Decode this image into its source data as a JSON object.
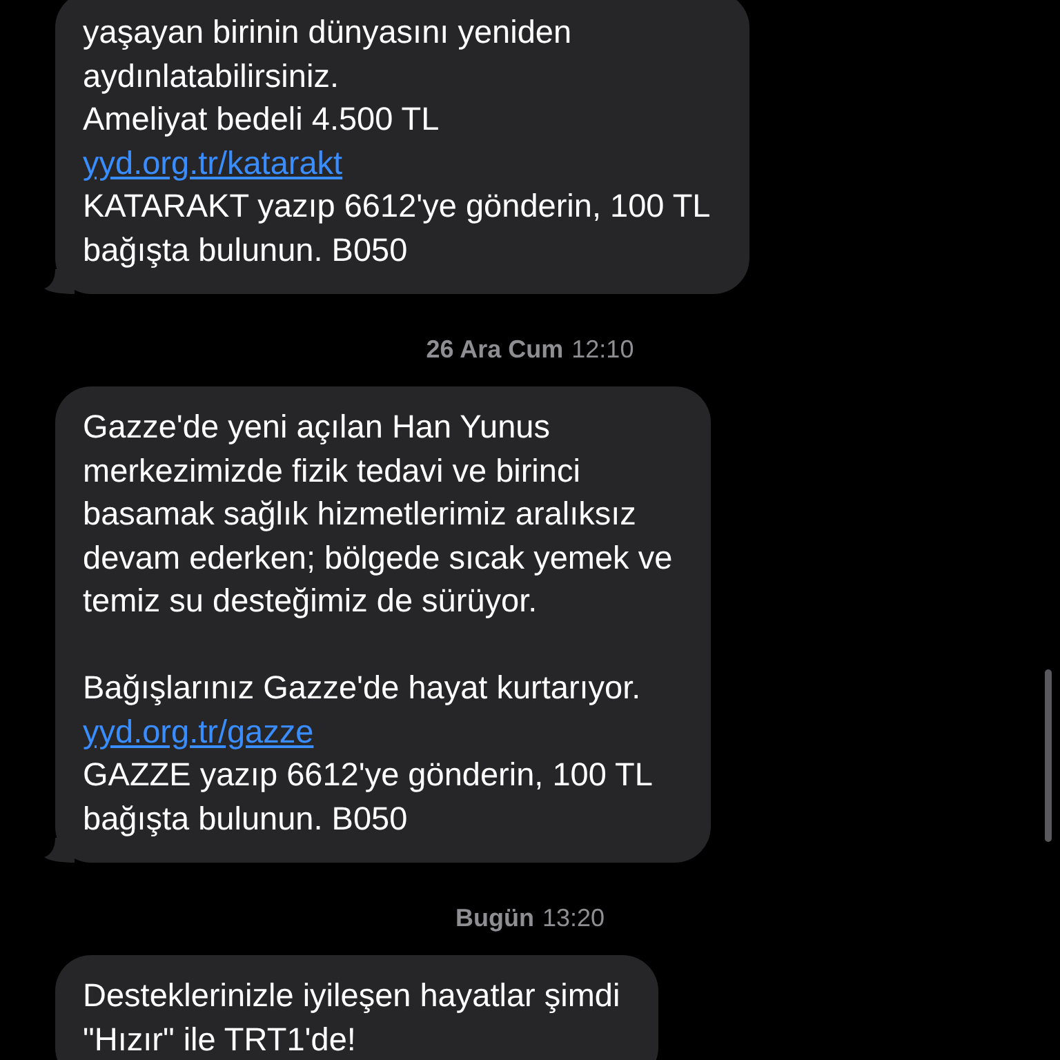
{
  "messages": [
    {
      "tail": true,
      "lines": [
        {
          "kind": "text",
          "text": "yaşayan birinin dünyasını yeniden"
        },
        {
          "kind": "text",
          "text": "aydınlatabilirsiniz."
        },
        {
          "kind": "text",
          "text": "Ameliyat bedeli 4.500 TL"
        },
        {
          "kind": "link",
          "text": "yyd.org.tr/katarakt"
        },
        {
          "kind": "text",
          "text": "KATARAKT yazıp 6612'ye gönderin, 100 TL"
        },
        {
          "kind": "text",
          "text": "bağışta bulunun. B050"
        }
      ]
    },
    {
      "timestamp": {
        "day": "26 Ara Cum",
        "time": "12:10"
      },
      "tail": true,
      "lines": [
        {
          "kind": "text",
          "text": "Gazze'de yeni açılan Han Yunus"
        },
        {
          "kind": "text",
          "text": "merkezimizde fizik tedavi ve birinci"
        },
        {
          "kind": "text",
          "text": "basamak sağlık hizmetlerimiz aralıksız"
        },
        {
          "kind": "text",
          "text": "devam ederken; bölgede sıcak yemek ve"
        },
        {
          "kind": "text",
          "text": "temiz su desteğimiz de sürüyor."
        },
        {
          "kind": "gap"
        },
        {
          "kind": "text",
          "text": "Bağışlarınız Gazze'de hayat kurtarıyor."
        },
        {
          "kind": "link",
          "text": "yyd.org.tr/gazze"
        },
        {
          "kind": "text",
          "text": "GAZZE yazıp 6612'ye gönderin, 100 TL"
        },
        {
          "kind": "text",
          "text": "bağışta bulunun. B050"
        }
      ]
    },
    {
      "timestamp": {
        "day": "Bugün",
        "time": "13:20"
      },
      "tail": false,
      "lines": [
        {
          "kind": "text",
          "text": "Desteklerinizle iyileşen hayatlar şimdi"
        },
        {
          "kind": "text",
          "text": "\"Hızır\" ile TRT1'de!"
        }
      ]
    }
  ]
}
